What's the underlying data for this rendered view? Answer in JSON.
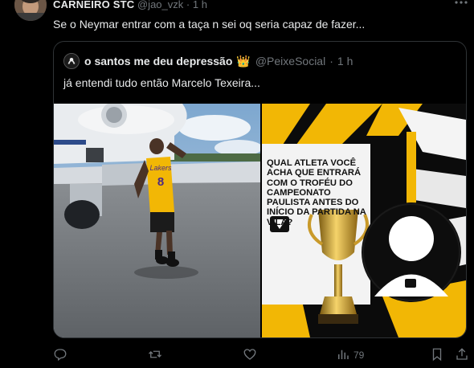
{
  "tweet": {
    "author_name": "CARNEIRO STC",
    "author_handle": "@jao_vzk",
    "separator": "·",
    "time": "1 h",
    "text": "Se o Neymar entrar com a taça n sei oq seria capaz de fazer..."
  },
  "quote": {
    "author_name": "o santos me deu depressão",
    "badge": "👑",
    "author_handle": "@PeixeSocial",
    "separator": "·",
    "time": "1 h",
    "text": "já entendi tudo então Marcelo Texeira...",
    "image_1": {
      "jersey_number": "8",
      "jersey_text": "Lakers"
    },
    "image_2": {
      "question": "QUAL ATLETA VOCÊ ACHA QUE ENTRARÁ COM O TROFÉU DO CAMPEONATO PAULISTA ANTES DO INÍCIO DA PARTIDA NA VILA?"
    }
  },
  "actions": {
    "reply_icon": "reply-icon",
    "retweet_icon": "retweet-icon",
    "like_icon": "heart-icon",
    "views_icon": "views-icon",
    "views_count": "79",
    "bookmark_icon": "bookmark-icon",
    "share_icon": "share-icon"
  },
  "colors": {
    "background": "#000000",
    "text": "#e7e9ea",
    "muted": "#71767b",
    "border": "#2f3336",
    "santos_gold": "#f2b705"
  }
}
